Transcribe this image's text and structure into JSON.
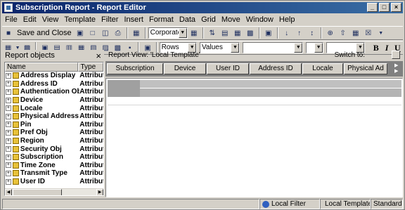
{
  "window": {
    "title": "Subscription Report - Report Editor",
    "controls": {
      "minimize": "_",
      "maximize": "□",
      "close": "×"
    }
  },
  "menu": [
    "File",
    "Edit",
    "View",
    "Template",
    "Filter",
    "Insert",
    "Format",
    "Data",
    "Grid",
    "Move",
    "Window",
    "Help"
  ],
  "toolbar1": {
    "save_close": "Save and Close",
    "template_combo": "Corporate"
  },
  "toolbar2": {
    "rows_combo": "Rows",
    "values_combo": "Values",
    "bold": "B",
    "italic": "I",
    "underline": "U"
  },
  "left_panel": {
    "title": "Report objects",
    "close": "×",
    "col_name": "Name",
    "col_type": "Type",
    "items": [
      {
        "name": "Address Display",
        "type": "Attribute"
      },
      {
        "name": "Address ID",
        "type": "Attribute"
      },
      {
        "name": "Authentication Obj",
        "type": "Attribute"
      },
      {
        "name": "Device",
        "type": "Attribute"
      },
      {
        "name": "Locale",
        "type": "Attribute"
      },
      {
        "name": "Physical Address",
        "type": "Attribute"
      },
      {
        "name": "Pin",
        "type": "Attribute"
      },
      {
        "name": "Pref Obj",
        "type": "Attribute"
      },
      {
        "name": "Region",
        "type": "Attribute"
      },
      {
        "name": "Security Obj",
        "type": "Attribute"
      },
      {
        "name": "Subscription",
        "type": "Attribute"
      },
      {
        "name": "Time Zone",
        "type": "Attribute"
      },
      {
        "name": "Transmit Type",
        "type": "Attribute"
      },
      {
        "name": "User ID",
        "type": "Attribute"
      }
    ]
  },
  "right_panel": {
    "view_label": "Report View: 'Local Template'",
    "switch_to": "Switch to:",
    "object_buttons": [
      "Subscription",
      "Device",
      "User ID",
      "Address ID",
      "Locale",
      "Physical Ad"
    ]
  },
  "status": {
    "local_filter": "Local Filter",
    "local_template": "Local Template",
    "standard": "Standard"
  }
}
